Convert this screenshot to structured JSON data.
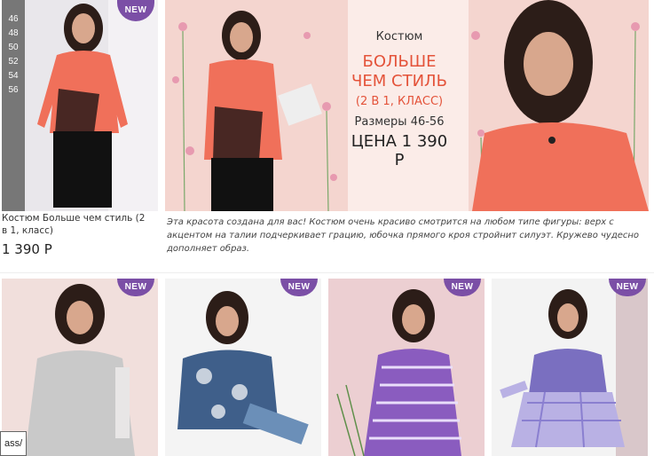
{
  "product": {
    "badge": "NEW",
    "sizes": [
      "46",
      "48",
      "50",
      "52",
      "54",
      "56"
    ],
    "caption": "Костюм Больше чем стиль (2 в 1, класс)",
    "price": "1 390 Р"
  },
  "banner": {
    "line1": "Костюм",
    "line2a": "БОЛЬШЕ",
    "line2b": "ЧЕМ СТИЛЬ",
    "line3": "(2 В 1, КЛАСС)",
    "line4": "Размеры 46-56",
    "line5": "ЦЕНА 1 390 Р"
  },
  "description": "Эта красота создана для вас! Костюм очень красиво смотрится на любом типе фигуры: верх с акцентом на талии подчеркивает грацию, юбочка прямого кроя стройнит силуэт. Кружево чудесно дополняет образ.",
  "grid": {
    "badges": [
      "NEW",
      "NEW",
      "NEW",
      "NEW"
    ]
  },
  "cart_tag": "ass/",
  "colors": {
    "badge": "#7b4fa6",
    "accent": "#e4533a",
    "coral": "#f0705a"
  }
}
